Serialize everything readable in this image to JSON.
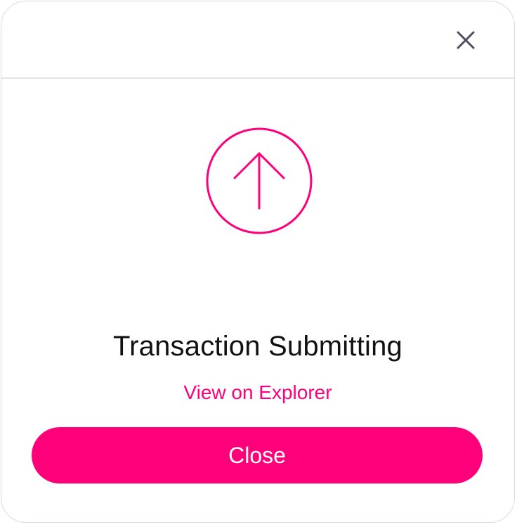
{
  "modal": {
    "title": "Transaction Submitting",
    "link_label": "View on Explorer",
    "close_button_label": "Close",
    "header_close_icon": "close-icon",
    "status_icon": "arrow-up-circle-icon"
  },
  "colors": {
    "accent": "#ff007a",
    "title_text": "#111111",
    "close_icon": "#4a4f5c",
    "border": "#dcdcdc"
  }
}
